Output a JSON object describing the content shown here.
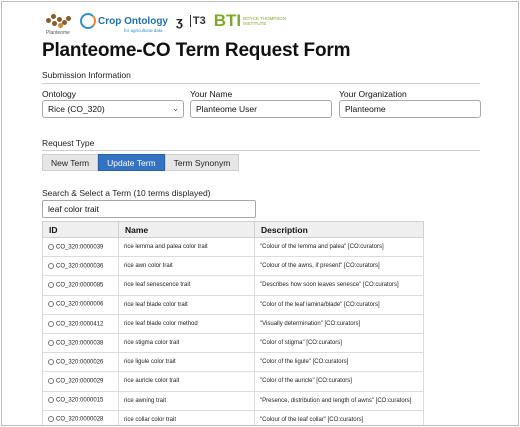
{
  "header": {
    "logos": {
      "planteome": "Planteome",
      "crop_ontology": "Crop Ontology",
      "crop_ontology_tagline": "for agricultural data",
      "bti": "BTI",
      "bti_sub": "BOYCE THOMPSON INSTITUTE"
    },
    "title": "Planteome-CO Term Request Form"
  },
  "submission": {
    "section_title": "Submission Information",
    "ontology_label": "Ontology",
    "ontology_value": "Rice (CO_320)",
    "name_label": "Your Name",
    "name_value": "Planteome User",
    "org_label": "Your Organization",
    "org_value": "Planteome"
  },
  "request_type": {
    "section_title": "Request Type",
    "tabs": [
      {
        "label": "New Term",
        "active": false
      },
      {
        "label": "Update Term",
        "active": true
      },
      {
        "label": "Term Synonym",
        "active": false
      }
    ]
  },
  "search": {
    "section_title": "Search & Select a Term (10 terms displayed)",
    "query": "leaf color trait"
  },
  "table": {
    "headers": [
      "ID",
      "Name",
      "Description"
    ],
    "rows": [
      {
        "id": "CO_320:0000039",
        "name": "rice lemma and palea color trait",
        "description": "\"Colour of the lemma and palea\" [CO:curators]"
      },
      {
        "id": "CO_320:0000036",
        "name": "rice awn color trait",
        "description": "\"Colour of the awns, if present\" [CO:curators]"
      },
      {
        "id": "CO_320:0000085",
        "name": "rice leaf senescence trait",
        "description": "\"Describes how soon leaves senesce\" [CO:curators]"
      },
      {
        "id": "CO_320:0000006",
        "name": "rice leaf blade color trait",
        "description": "\"Color of the leaf lamina/blade\" [CO:curators]"
      },
      {
        "id": "CO_320:0000412",
        "name": "rice leaf blade color method",
        "description": "\"Visually determination\" [CO:curators]"
      },
      {
        "id": "CO_320:0000038",
        "name": "rice stigma color trait",
        "description": "\"Color of stigma\" [CO:curators]"
      },
      {
        "id": "CO_320:0000026",
        "name": "rice ligule color trait",
        "description": "\"Color of the ligule\" [CO:curators]"
      },
      {
        "id": "CO_320:0000029",
        "name": "rice auricle color trait",
        "description": "\"Color of the auricle\" [CO:curators]"
      },
      {
        "id": "CO_320:0000015",
        "name": "rice awning trait",
        "description": "\"Presence, distribution and length of awns\" [CO:curators]"
      },
      {
        "id": "CO_320:0000028",
        "name": "rice collar color trait",
        "description": "\"Colour of the leaf collar\" [CO:curators]"
      }
    ]
  },
  "colors": {
    "active_tab": "#3473c4",
    "bti_green": "#7ea92b",
    "crop_ontology_blue": "#1f6fb3"
  },
  "icons": [
    "planteome-logo-icon",
    "crop-ontology-logo-icon",
    "g3-logo-icon",
    "t3-logo-icon",
    "chevron-down-icon",
    "radio-icon"
  ]
}
